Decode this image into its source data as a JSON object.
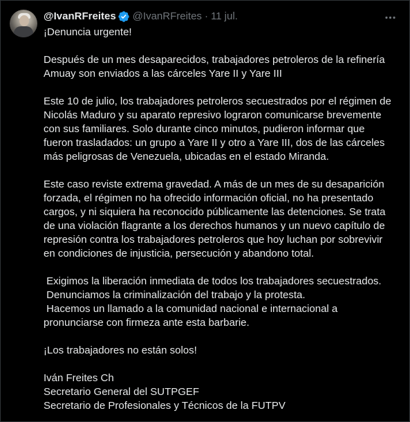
{
  "author": {
    "display_name": "@IvanRFreites",
    "handle": "@IvanRFreites",
    "separator": "·",
    "date": "11 jul.",
    "verified_color": "#1d9bf0",
    "avatar_icon": "profile-photo"
  },
  "colors": {
    "background": "#000000",
    "text": "#e7e9ea",
    "secondary_text": "#71767b"
  },
  "tweet": {
    "paragraphs": [
      "¡Denuncia urgente!",
      "Después de un mes desaparecidos, trabajadores petroleros de la refinería\nAmuay son enviados a las cárceles Yare II y Yare III",
      "Este 10 de julio, los trabajadores petroleros secuestrados por el régimen de\nNicolás Maduro y su aparato represivo lograron comunicarse brevemente\ncon sus familiares. Solo durante cinco minutos, pudieron informar que\nfueron trasladados: un grupo a Yare II y otro a Yare III, dos de las cárceles\nmás peligrosas de Venezuela, ubicadas en el estado Miranda.",
      "Este caso reviste extrema gravedad. A más de un mes de su desaparición\nforzada, el régimen no ha ofrecido información oficial, no ha presentado\ncargos, y ni siquiera ha reconocido públicamente las detenciones. Se trata\nde una violación flagrante a los derechos humanos y un nuevo capítulo de\nrepresión contra los trabajadores petroleros que hoy luchan por sobrevivir\nen condiciones de injusticia, persecución y abandono total.",
      " Exigimos la liberación inmediata de todos los trabajadores secuestrados.\n Denunciamos la criminalización del trabajo y la protesta.\n Hacemos un llamado a la comunidad nacional e internacional a\npronunciarse con firmeza ante esta barbarie.",
      "¡Los trabajadores no están solos!",
      "Iván Freites Ch\nSecretario General del SUTPGEF\nSecretario de Profesionales y Técnicos de la FUTPV"
    ]
  }
}
